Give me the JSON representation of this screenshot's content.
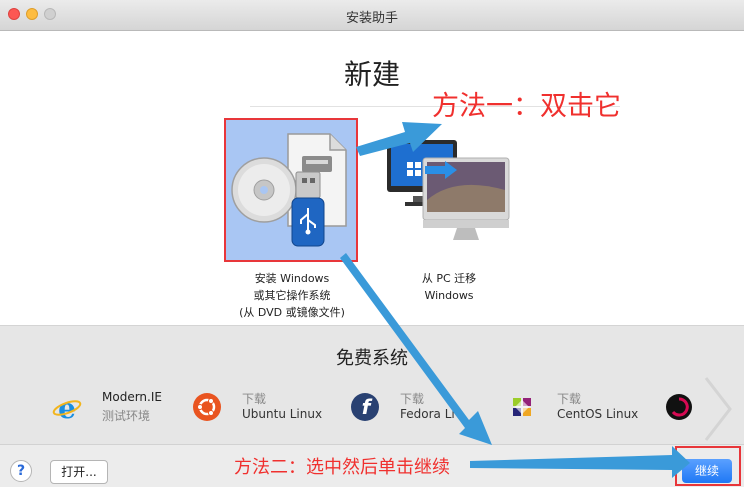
{
  "window": {
    "title": "安装助手"
  },
  "main": {
    "heading": "新建",
    "options": [
      {
        "line1": "安装 Windows",
        "line2": "或其它操作系统",
        "line3": "(从 DVD 或镜像文件)",
        "selected": true
      },
      {
        "line1": "从 PC 迁移",
        "line2": "Windows",
        "line3": "",
        "selected": false
      }
    ]
  },
  "free_systems": {
    "title": "免费系统",
    "items": [
      {
        "line1": "Modern.IE",
        "line2": "测试环境",
        "icon": "internet-explorer-icon"
      },
      {
        "line1": "下载",
        "line2": "Ubuntu Linux",
        "icon": "ubuntu-icon"
      },
      {
        "line1": "下载",
        "line2": "Fedora Li",
        "icon": "fedora-icon"
      },
      {
        "line1": "下载",
        "line2": "CentOS Linux",
        "icon": "centos-icon"
      },
      {
        "line1": "",
        "line2": "",
        "icon": "debian-icon"
      }
    ]
  },
  "footer": {
    "help_label": "?",
    "open_label": "打开...",
    "continue_label": "继续"
  },
  "annotations": {
    "method1": "方法一：双击它",
    "method2": "方法二：选中然后单击继续"
  },
  "colors": {
    "annotation_red": "#f0302e",
    "arrow_blue": "#3a9ad9",
    "selection_blue": "#a9c6f3",
    "continue_blue": "#1f78f5"
  }
}
